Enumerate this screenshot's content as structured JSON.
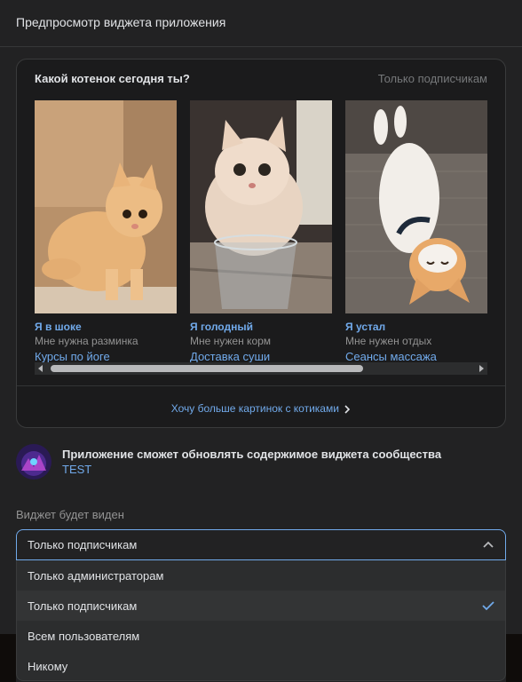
{
  "header": {
    "title": "Предпросмотр виджета приложения"
  },
  "widget": {
    "title": "Какой котенок сегодня ты?",
    "audience_tag": "Только подписчикам",
    "tiles": [
      {
        "title": "Я в шоке",
        "subtitle": "Мне нужна разминка",
        "link": "Курсы по йоге"
      },
      {
        "title": "Я голодный",
        "subtitle": "Мне нужен корм",
        "link": "Доставка суши"
      },
      {
        "title": "Я устал",
        "subtitle": "Мне нужен отдых",
        "link": "Сеансы массажа"
      }
    ],
    "more_link": "Хочу больше картинок с котиками"
  },
  "app": {
    "permission_text": "Приложение сможет обновлять содержимое виджета сообщества",
    "name": "TEST"
  },
  "visibility": {
    "label": "Виджет будет виден",
    "selected": "Только подписчикам",
    "options": [
      {
        "label": "Только администраторам",
        "selected": false
      },
      {
        "label": "Только подписчикам",
        "selected": true
      },
      {
        "label": "Всем пользователям",
        "selected": false
      },
      {
        "label": "Никому",
        "selected": false
      }
    ]
  },
  "colors": {
    "accent": "#71aaeb",
    "background": "#222223"
  },
  "icons": [
    "chevron-right-icon",
    "chevron-up-icon",
    "check-icon",
    "scroll-left-icon",
    "scroll-right-icon"
  ]
}
